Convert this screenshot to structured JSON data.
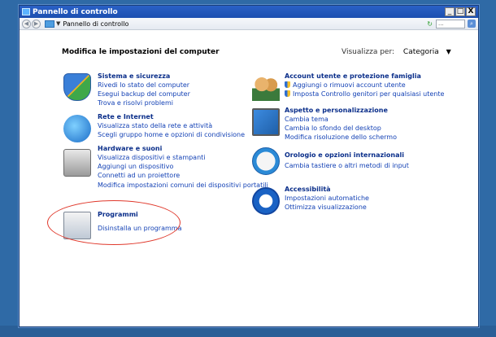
{
  "window": {
    "title": "Pannello di controllo",
    "controls": {
      "minimize": "_",
      "maximize": "□",
      "close": "X"
    }
  },
  "address": {
    "nav_back": "◀",
    "nav_forward": "▶",
    "arrow": "▼",
    "path": "Pannello di controllo",
    "refresh": "↻",
    "search_value": "...",
    "search_icon": "⌕"
  },
  "header": {
    "title": "Modifica le impostazioni del computer",
    "view_by_label": "Visualizza per:",
    "view_by_value": "Categoria",
    "view_by_arrow": "▼"
  },
  "categories_left": [
    {
      "name": "Sistema e sicurezza",
      "icon": "shield-icon",
      "links": [
        "Rivedi lo stato del computer",
        "Esegui backup del computer",
        "Trova e risolvi problemi"
      ]
    },
    {
      "name": "Rete e Internet",
      "icon": "network-icon",
      "links": [
        "Visualizza stato della rete e attività",
        "Scegli gruppo home e opzioni di condivisione"
      ]
    },
    {
      "name": "Hardware e suoni",
      "icon": "printer-icon",
      "links": [
        "Visualizza dispositivi e stampanti",
        "Aggiungi un dispositivo",
        "Connetti ad un proiettore",
        "Modifica impostazioni comuni dei dispositivi portatili"
      ]
    },
    {
      "name": "Programmi",
      "icon": "programs-icon",
      "links": [
        "Disinstalla un programma"
      ]
    }
  ],
  "categories_right": [
    {
      "name": "Account utente e protezione famiglia",
      "icon": "users-icon",
      "links": [
        "Aggiungi o rimuovi account utente",
        "Imposta Controllo genitori per qualsiasi utente"
      ]
    },
    {
      "name": "Aspetto e personalizzazione",
      "icon": "appearance-icon",
      "links": [
        "Cambia tema",
        "Cambia lo sfondo del desktop",
        "Modifica risoluzione dello schermo"
      ]
    },
    {
      "name": "Orologio e opzioni internazionali",
      "icon": "clock-globe-icon",
      "links": [
        "Cambia tastiere o altri metodi di input"
      ]
    },
    {
      "name": "Accessibilità",
      "icon": "accessibility-icon",
      "links": [
        "Impostazioni automatiche",
        "Ottimizza visualizzazione"
      ]
    }
  ],
  "colors": {
    "heading": "#0a2e8a",
    "link": "#1442b5",
    "highlight_oval": "#e0392c",
    "titlebar": "#1c4fb0"
  }
}
